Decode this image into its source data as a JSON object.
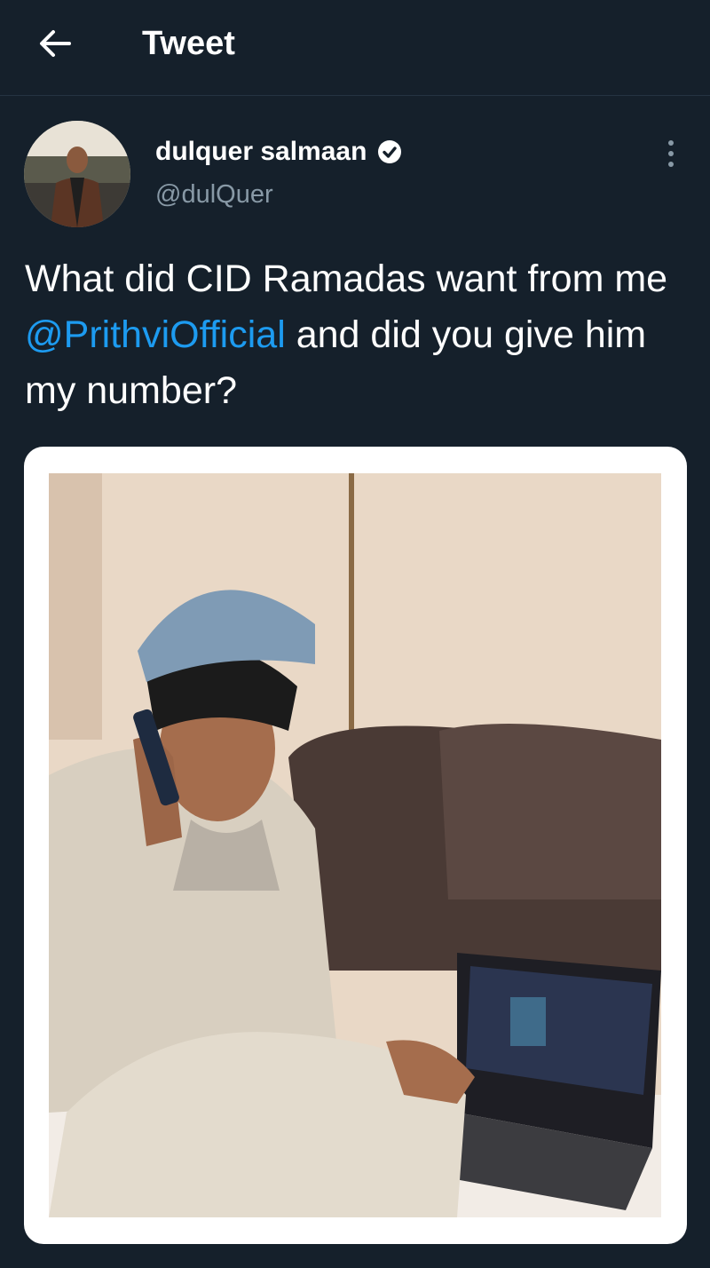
{
  "header": {
    "title": "Tweet",
    "back_icon": "arrow-left-icon"
  },
  "author": {
    "name": "dulquer salmaan",
    "handle": "@dulQuer",
    "verified_icon": "verified-badge-icon",
    "more_icon": "more-vertical-icon"
  },
  "tweet": {
    "text_before": "What did CID Ramadas want from me ",
    "mention": "@PrithviOfficial",
    "text_after": " and did you give him my number?"
  },
  "colors": {
    "background": "#15202b",
    "mention": "#1d9bf0",
    "secondary_text": "#8899a6"
  }
}
